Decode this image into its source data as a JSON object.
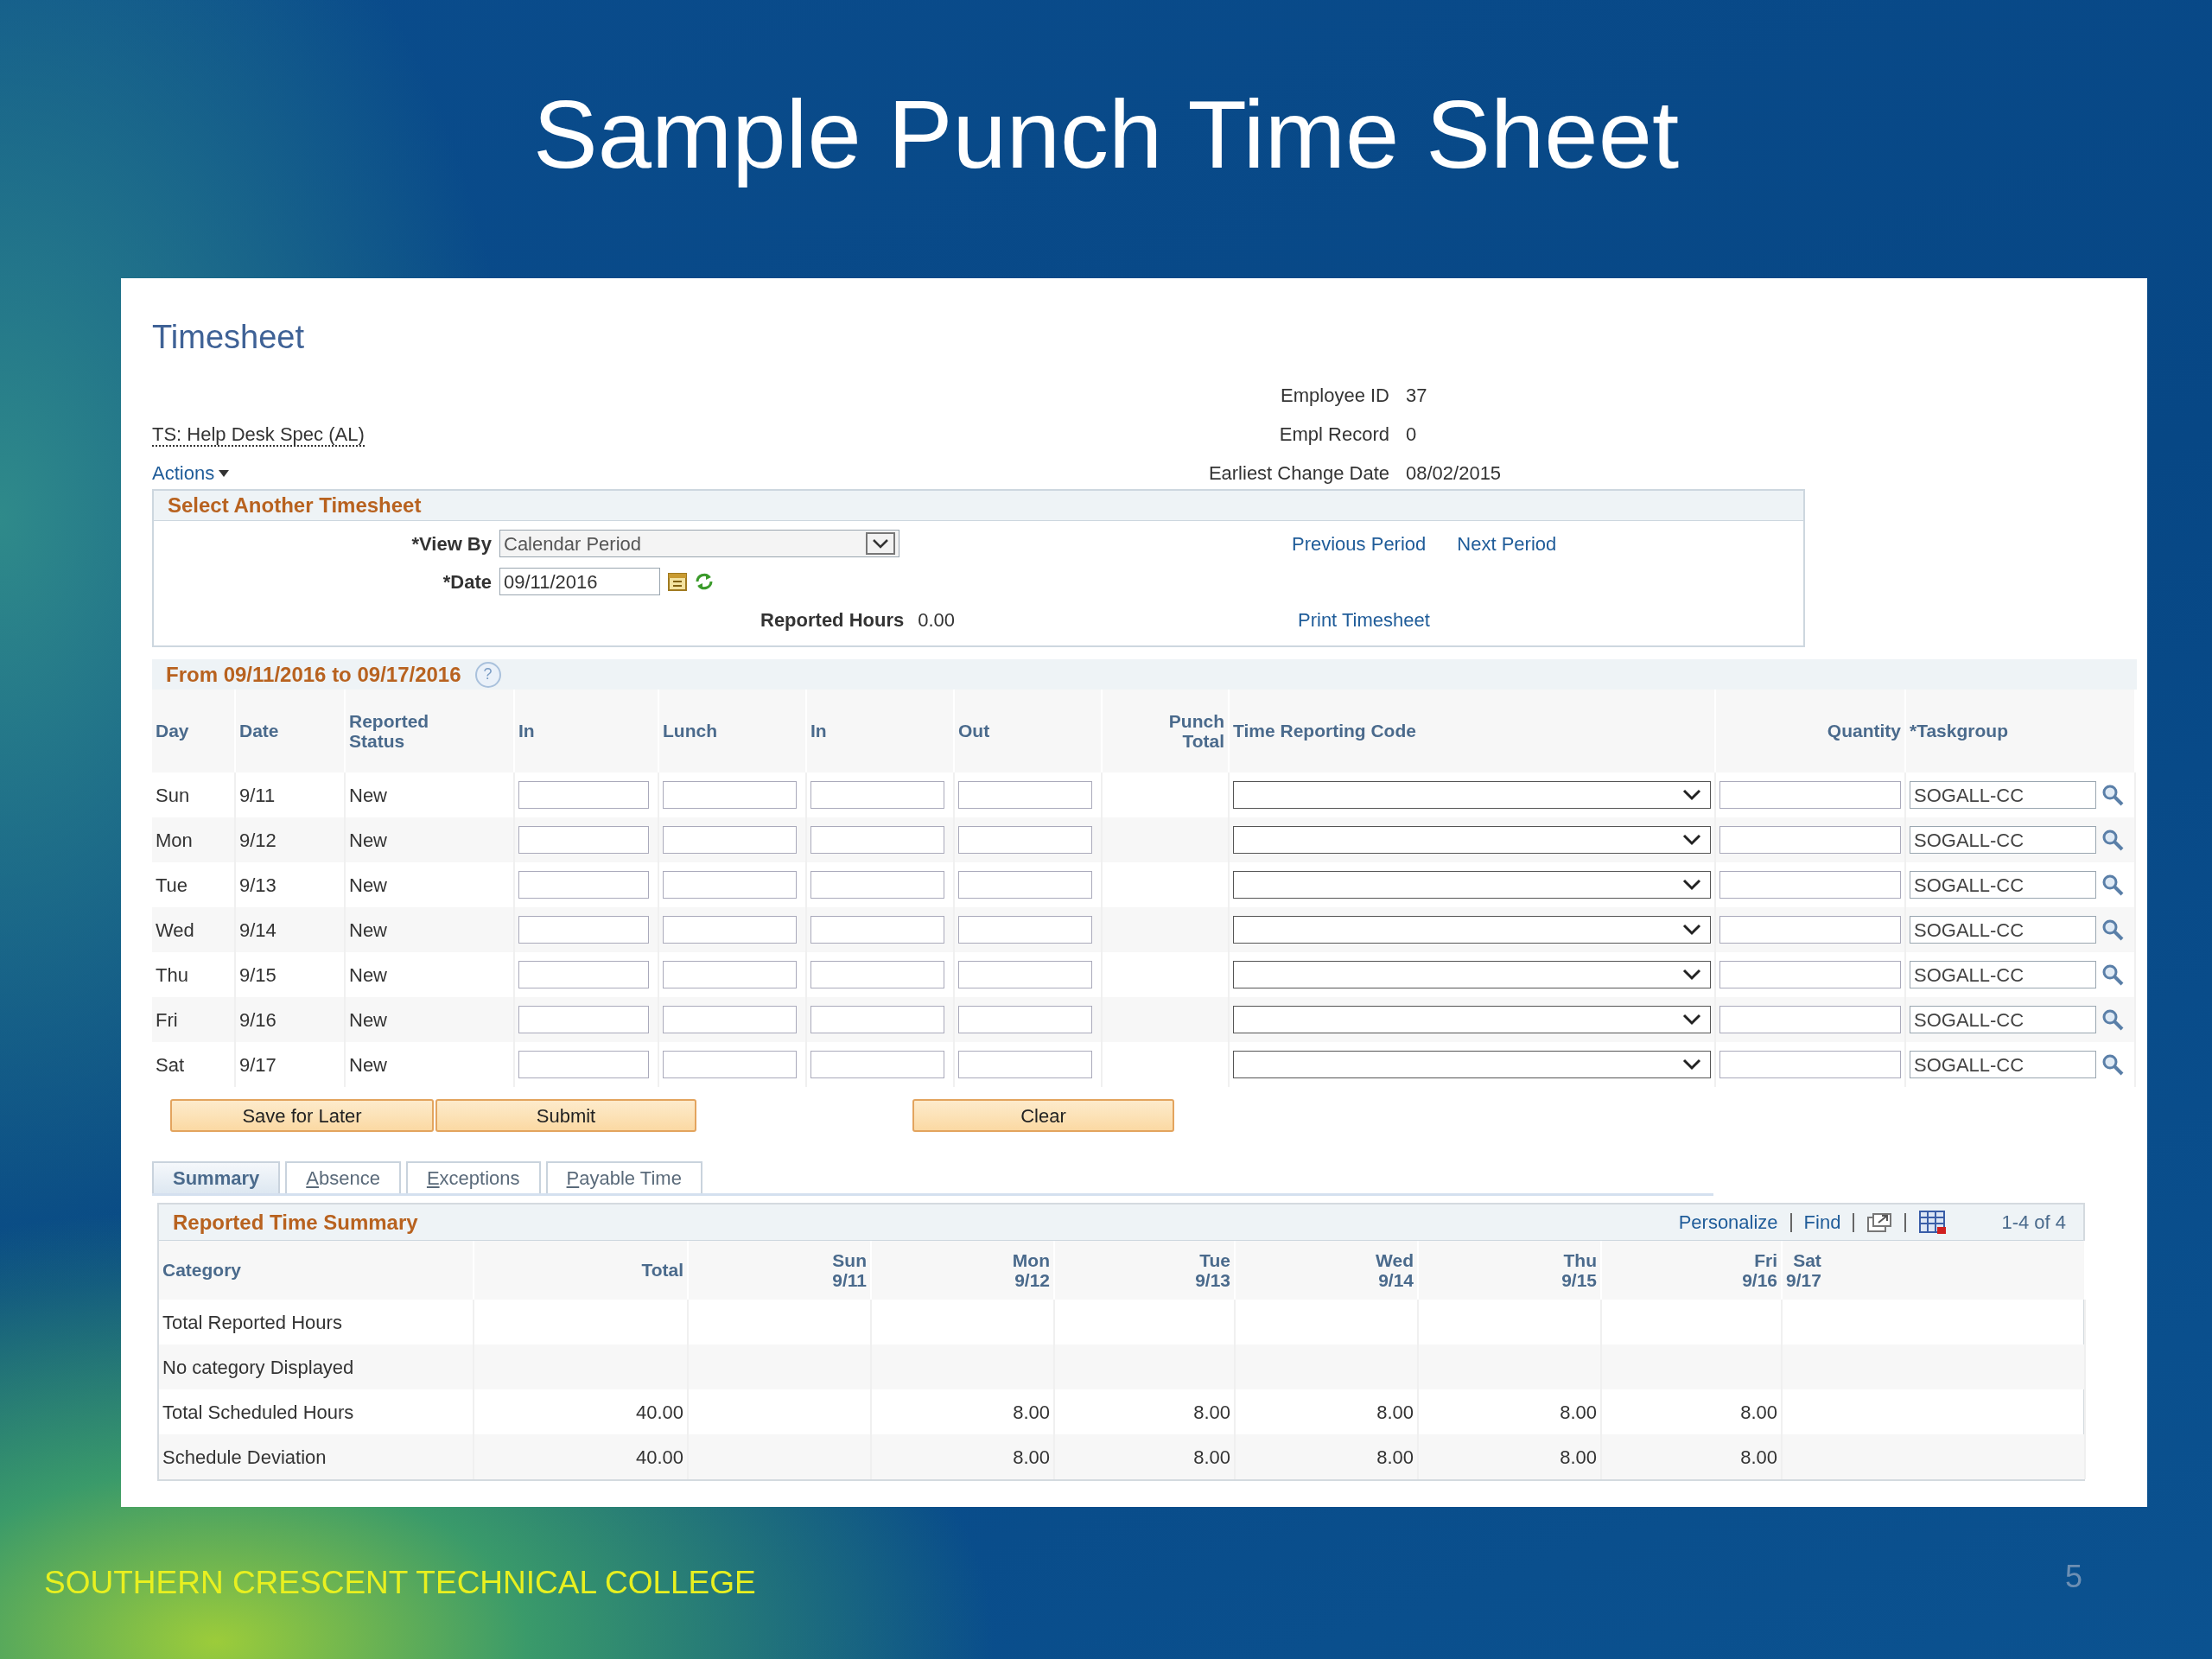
{
  "slide": {
    "title": "Sample Punch Time Sheet",
    "footer": "SOUTHERN CRESCENT TECHNICAL COLLEGE",
    "page_number": "5"
  },
  "page": {
    "title": "Timesheet",
    "job_title": "TS: Help Desk Spec (AL)",
    "actions": "Actions",
    "info": [
      {
        "label": "Employee ID",
        "value": "37"
      },
      {
        "label": "Empl Record",
        "value": "0"
      },
      {
        "label": "Earliest Change Date",
        "value": "08/02/2015"
      }
    ]
  },
  "select_timesheet": {
    "heading": "Select Another Timesheet",
    "view_by": {
      "label": "*View By",
      "value": "Calendar Period"
    },
    "date": {
      "label": "*Date",
      "value": "09/11/2016"
    },
    "reported_hours": {
      "label": "Reported Hours",
      "value": "0.00"
    },
    "period_links": [
      "Previous Period",
      "Next Period"
    ],
    "print_link": "Print Timesheet"
  },
  "timesheet": {
    "heading": "From 09/11/2016 to 09/17/2016",
    "help": "?",
    "columns": [
      "Day",
      "Date",
      "Reported Status",
      "In",
      "Lunch",
      "In",
      "Out",
      "Punch Total",
      "Time Reporting Code",
      "Quantity",
      "*Taskgroup"
    ],
    "rows": [
      {
        "day": "Sun",
        "date": "9/11",
        "status": "New",
        "taskgroup": "SOGALL-CC"
      },
      {
        "day": "Mon",
        "date": "9/12",
        "status": "New",
        "taskgroup": "SOGALL-CC"
      },
      {
        "day": "Tue",
        "date": "9/13",
        "status": "New",
        "taskgroup": "SOGALL-CC"
      },
      {
        "day": "Wed",
        "date": "9/14",
        "status": "New",
        "taskgroup": "SOGALL-CC"
      },
      {
        "day": "Thu",
        "date": "9/15",
        "status": "New",
        "taskgroup": "SOGALL-CC"
      },
      {
        "day": "Fri",
        "date": "9/16",
        "status": "New",
        "taskgroup": "SOGALL-CC"
      },
      {
        "day": "Sat",
        "date": "9/17",
        "status": "New",
        "taskgroup": "SOGALL-CC"
      }
    ]
  },
  "buttons": [
    "Save for Later",
    "Submit",
    "Clear"
  ],
  "tabs": [
    {
      "label": "Summary",
      "selected": true,
      "hotkey": false
    },
    {
      "label": "Absence",
      "selected": false,
      "hotkey": true
    },
    {
      "label": "Exceptions",
      "selected": false,
      "hotkey": true
    },
    {
      "label": "Payable Time",
      "selected": false,
      "hotkey": true
    }
  ],
  "summary": {
    "heading": "Reported Time Summary",
    "toolbar_links": [
      "Personalize",
      "Find"
    ],
    "count": "1-4 of 4",
    "columns": [
      {
        "label": "Category"
      },
      {
        "label": "Total"
      },
      {
        "label": "Sun",
        "sub": "9/11"
      },
      {
        "label": "Mon",
        "sub": "9/12"
      },
      {
        "label": "Tue",
        "sub": "9/13"
      },
      {
        "label": "Wed",
        "sub": "9/14"
      },
      {
        "label": "Thu",
        "sub": "9/15"
      },
      {
        "label": "Fri",
        "sub": "9/16"
      },
      {
        "label": "Sat",
        "sub": "9/17"
      }
    ],
    "rows": [
      {
        "category": "Total Reported Hours"
      },
      {
        "category": "No category Displayed"
      },
      {
        "category": "Total Scheduled Hours",
        "total": "40.00",
        "mon": "8.00",
        "tue": "8.00",
        "wed": "8.00",
        "thu": "8.00",
        "fri": "8.00"
      },
      {
        "category": "Schedule Deviation",
        "total": "40.00",
        "mon": "8.00",
        "tue": "8.00",
        "wed": "8.00",
        "thu": "8.00",
        "fri": "8.00"
      }
    ]
  }
}
